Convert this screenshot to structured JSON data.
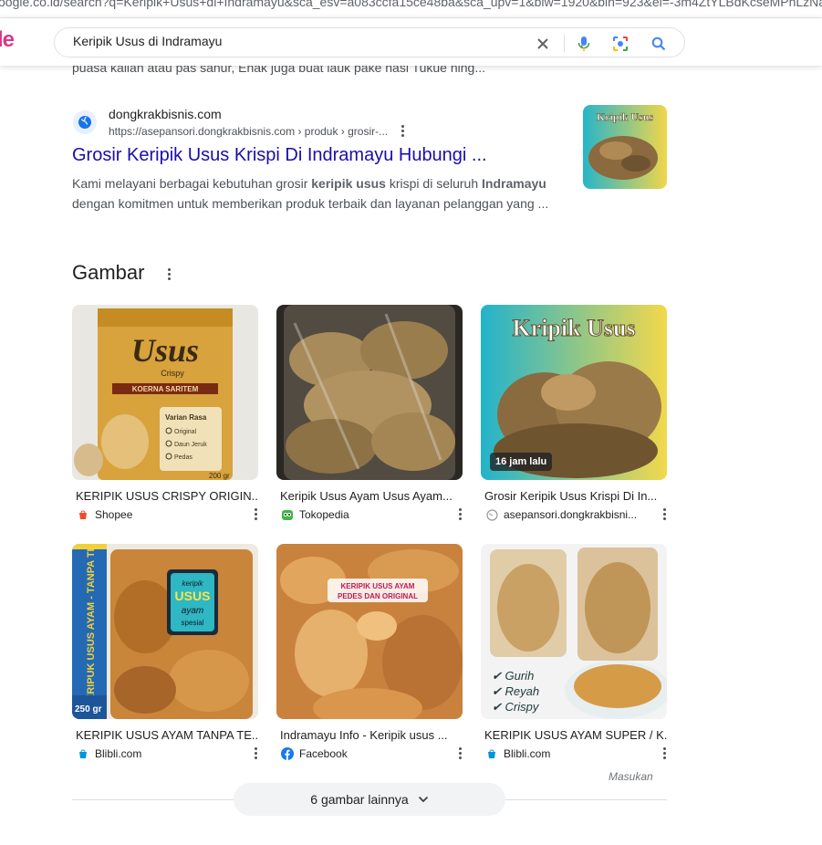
{
  "browser": {
    "url": "oogle.co.id/search?q=Keripik+Usus+di+Indramayu&sca_esv=a083ccfa15ce48ba&sca_upv=1&biw=1920&bih=923&ei=-3m4ZtYLBdKcseMPhLzNa"
  },
  "header": {
    "logo_text": "le",
    "search_value": "Keripik Usus di Indramayu"
  },
  "cut_snippet": "puasa kalian atau pas sahur, Enak juga buat lauk pake nasi Tukue hing...",
  "result": {
    "site_name": "dongkrakbisnis.com",
    "url_crumbs": "https://asepansori.dongkrakbisnis.com › produk › grosir-...",
    "title": "Grosir Keripik Usus Krispi Di Indramayu Hubungi ...",
    "snippet_a": "Kami melayani berbagai kebutuhan grosir ",
    "snippet_b": "keripik usus",
    "snippet_c": " krispi di seluruh ",
    "snippet_d": "Indramayu",
    "snippet_line2": "dengan komitmen untuk memberikan produk terbaik dan layanan pelanggan yang ...",
    "thumb_text": "Kripik Usus"
  },
  "images": {
    "title": "Gambar",
    "items": [
      {
        "caption": "KERIPIK USUS CRISPY ORIGIN...",
        "source": "Shopee",
        "source_color": "#ee4d2d",
        "art": {
          "brand": "Usus",
          "sub": "Crispy",
          "tag": "KOERNA SARITEM",
          "note": "Varian Rasa",
          "opts": [
            "Original",
            "Daun Jeruk",
            "Pedas"
          ],
          "weight": "200 gr"
        }
      },
      {
        "caption": "Keripik Usus Ayam Usus Ayam...",
        "source": "Tokopedia",
        "source_color": "#42b549"
      },
      {
        "caption": "Grosir Keripik Usus Krispi Di In...",
        "source": "asepansori.dongkrakbisni...",
        "source_color": "#9aa0a6",
        "badge": "16 jam lalu",
        "art": {
          "title": "Kripik Usus"
        }
      },
      {
        "caption": "KERIPIK USUS AYAM TANPA TE...",
        "source": "Blibli.com",
        "source_color": "#0095da",
        "art": {
          "side": "KERIPUK USUS AYAM - TANPA TEPUNG -",
          "weight": "250 gr",
          "label1": "keripik",
          "label2": "USUS",
          "label3": "ayam",
          "label4": "spesial"
        }
      },
      {
        "caption": "Indramayu Info - Keripik usus ...",
        "source": "Facebook",
        "source_color": "#1877f2",
        "art": {
          "line1": "KERIPIK USUS AYAM",
          "line2": "PEDES DAN ORIGINAL"
        }
      },
      {
        "caption": "KERIPIK USUS AYAM SUPER / K...",
        "source": "Blibli.com",
        "source_color": "#0095da",
        "art": {
          "checks": [
            "Gurih",
            "Reyah",
            "Crispy"
          ]
        }
      }
    ],
    "feedback": "Masukan",
    "more_label": "6 gambar lainnya"
  }
}
